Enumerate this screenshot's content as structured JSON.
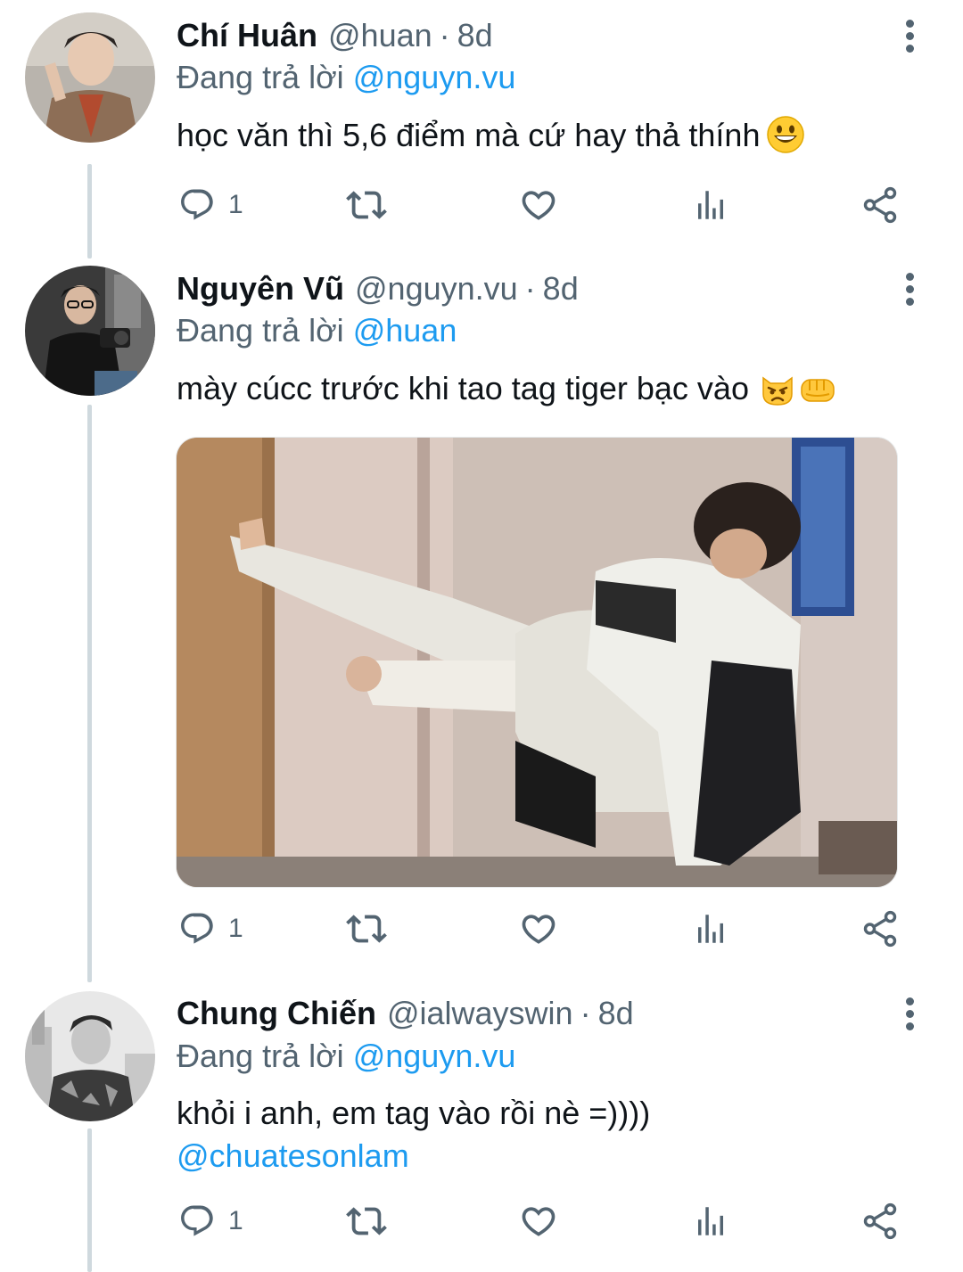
{
  "tweets": [
    {
      "display_name": "Chí Huân",
      "handle": "@huan",
      "dot": "·",
      "time": "8d",
      "reply_prefix": "Đang trả lời",
      "reply_to": "@nguyn.vu",
      "text": "học văn thì 5,6 điểm mà cứ hay thả thính",
      "emoji": "grinning-face-emoji",
      "reply_count": "1"
    },
    {
      "display_name": "Nguyên Vũ",
      "handle": "@nguyn.vu",
      "dot": "·",
      "time": "8d",
      "reply_prefix": "Đang trả lời",
      "reply_to": "@huan",
      "text": "mày cúcc trước khi tao tag tiger bạc vào",
      "emoji": [
        "pouting-cat-emoji",
        "oncoming-fist-emoji"
      ],
      "media": "photo-kick-meme",
      "reply_count": "1"
    },
    {
      "display_name": "Chung Chiến",
      "handle": "@ialwayswin",
      "dot": "·",
      "time": "8d",
      "reply_prefix": "Đang trả lời",
      "reply_to": "@nguyn.vu",
      "text": "khỏi i anh, em tag vào rồi nè =))))",
      "mention": "@chuatesonlam",
      "reply_count": "1"
    }
  ],
  "icons": {
    "reply": "reply-icon",
    "retweet": "retweet-icon",
    "like": "like-icon",
    "views": "views-icon",
    "share": "share-icon",
    "more": "more-icon"
  },
  "colors": {
    "link": "#1d9bf0",
    "secondary_text": "#536471",
    "primary_text": "#0f1419",
    "thread_line": "#cfd9de"
  }
}
